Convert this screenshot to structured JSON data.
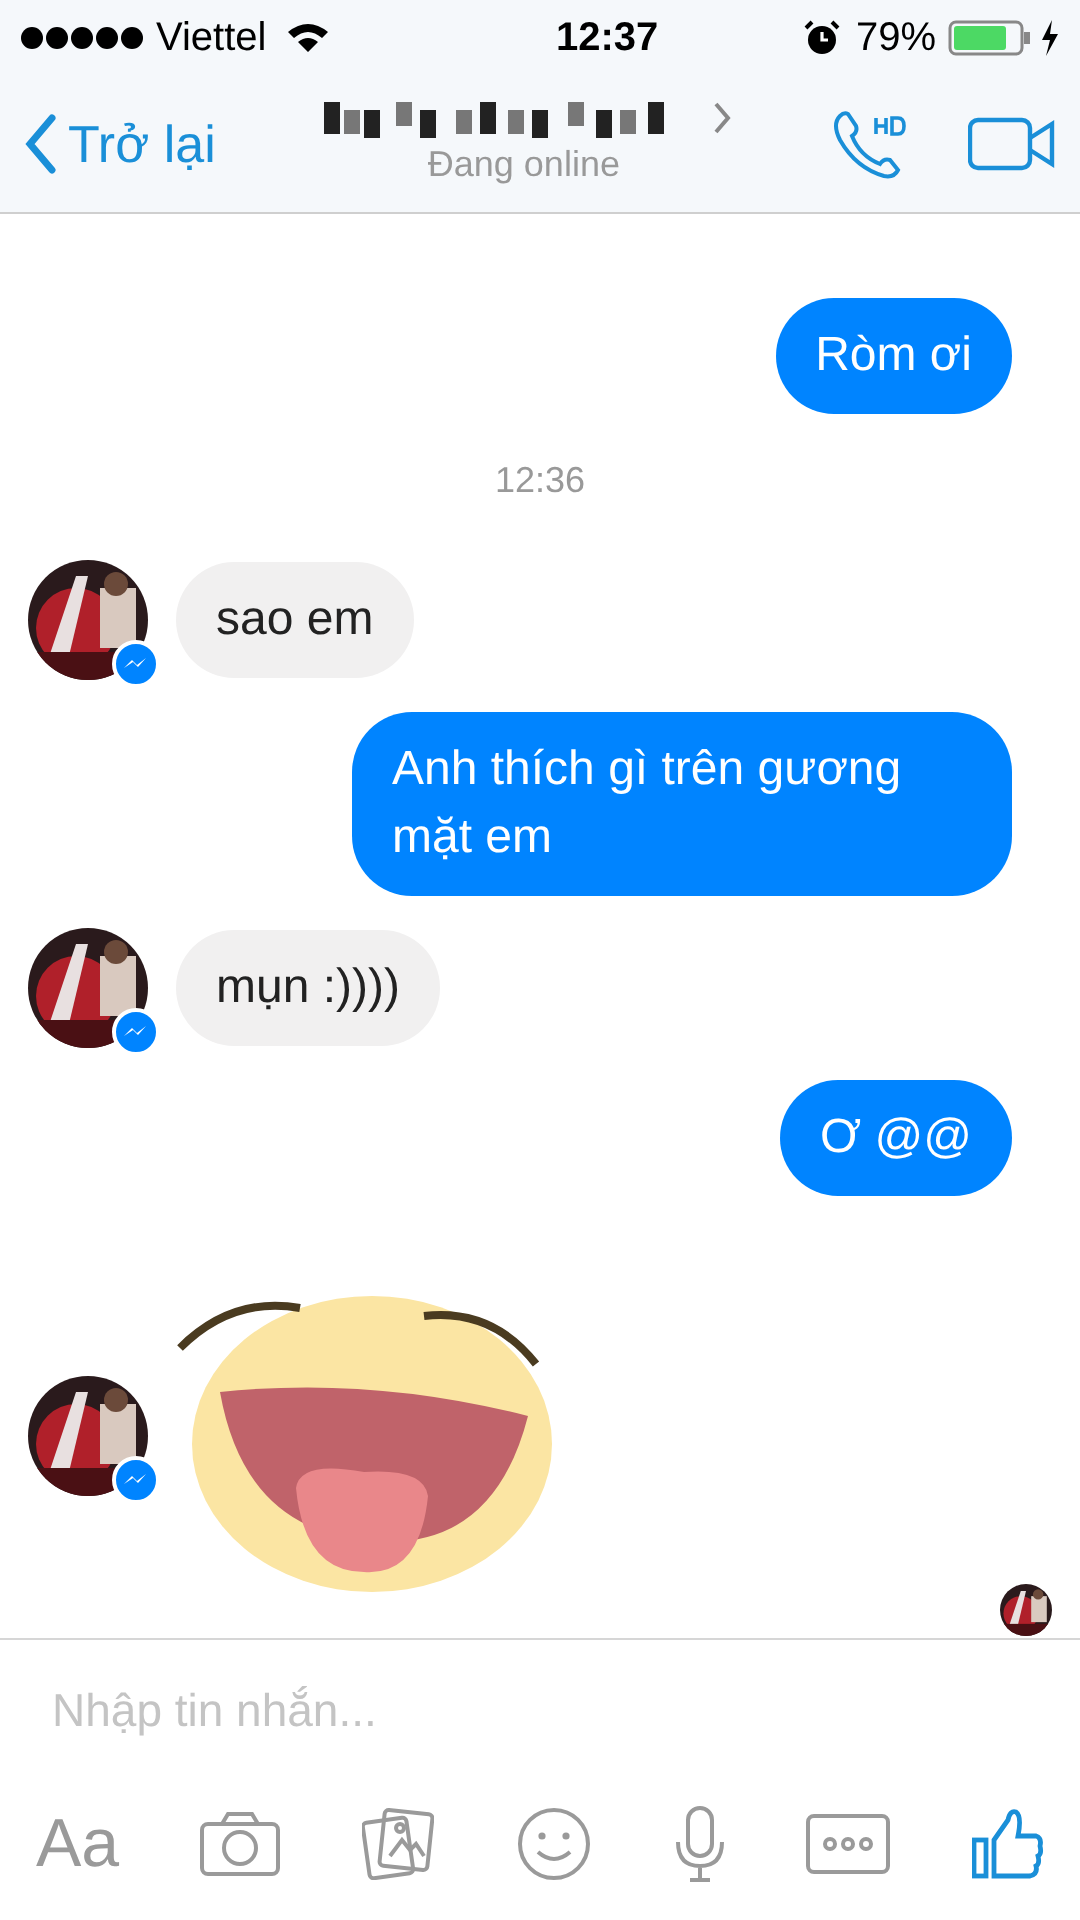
{
  "status_bar": {
    "carrier": "Viettel",
    "time": "12:37",
    "battery": "79%"
  },
  "nav": {
    "back": "Trở lại",
    "subtitle": "Đang online"
  },
  "messages": [
    {
      "kind": "text",
      "outgoing": true,
      "text": "Ròm ơi"
    },
    {
      "kind": "time",
      "text": "12:36"
    },
    {
      "kind": "text",
      "outgoing": false,
      "text": "sao em"
    },
    {
      "kind": "text",
      "outgoing": true,
      "text": "Anh thích gì trên gương mặt em"
    },
    {
      "kind": "text",
      "outgoing": false,
      "text": "mụn :))))"
    },
    {
      "kind": "text",
      "outgoing": true,
      "text": "Ơ @@"
    },
    {
      "kind": "sticker",
      "outgoing": false
    }
  ],
  "composer": {
    "placeholder": "Nhập tin nhắn..."
  },
  "toolbar": [
    {
      "kind": "text",
      "label": "Aa"
    },
    {
      "kind": "camera"
    },
    {
      "kind": "photos"
    },
    {
      "kind": "emoji"
    },
    {
      "kind": "mic"
    },
    {
      "kind": "more"
    },
    {
      "kind": "like"
    }
  ]
}
